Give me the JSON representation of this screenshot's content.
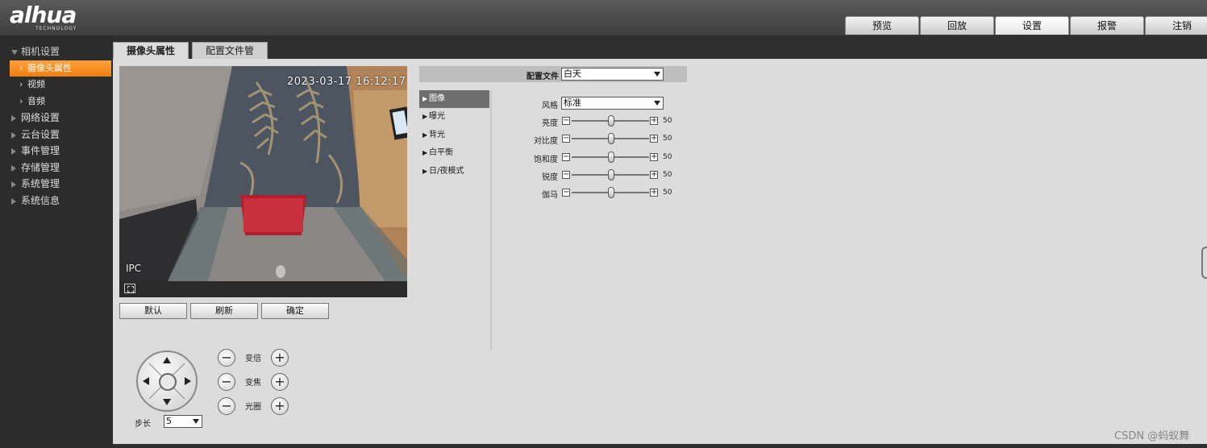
{
  "brand": {
    "logo": "alhua",
    "tagline": "TECHNOLOGY"
  },
  "nav": [
    "预览",
    "回放",
    "设置",
    "报警",
    "注销"
  ],
  "nav_active": "设置",
  "sidebar": {
    "camera_group": "相机设置",
    "camera_items": [
      "摄像头属性",
      "视频",
      "音频"
    ],
    "groups": [
      "网络设置",
      "云台设置",
      "事件管理",
      "存储管理",
      "系统管理",
      "系统信息"
    ]
  },
  "tabs": [
    "摄像头属性",
    "配置文件管理"
  ],
  "video": {
    "timestamp": "2023-03-17 16:12:17",
    "osd_corner": "IPC"
  },
  "actions": {
    "default": "默认",
    "refresh": "刷新",
    "confirm": "确定"
  },
  "ptz": {
    "zoom": "变倍",
    "focus": "变焦",
    "iris": "光圈",
    "step_label": "步长",
    "step_value": "5",
    "minus": "−",
    "plus": "+"
  },
  "config": {
    "profile_label": "配置文件",
    "profile_value": "白天",
    "subnav": [
      "图像",
      "曝光",
      "背光",
      "白平衡",
      "日/夜模式"
    ],
    "style_label": "风格",
    "style_value": "标准",
    "sliders": [
      {
        "label": "亮度",
        "value": 50
      },
      {
        "label": "对比度",
        "value": 50
      },
      {
        "label": "饱和度",
        "value": 50
      },
      {
        "label": "锐度",
        "value": 50
      },
      {
        "label": "伽马",
        "value": 50
      }
    ]
  },
  "watermark": "CSDN @蚂蚁舞"
}
